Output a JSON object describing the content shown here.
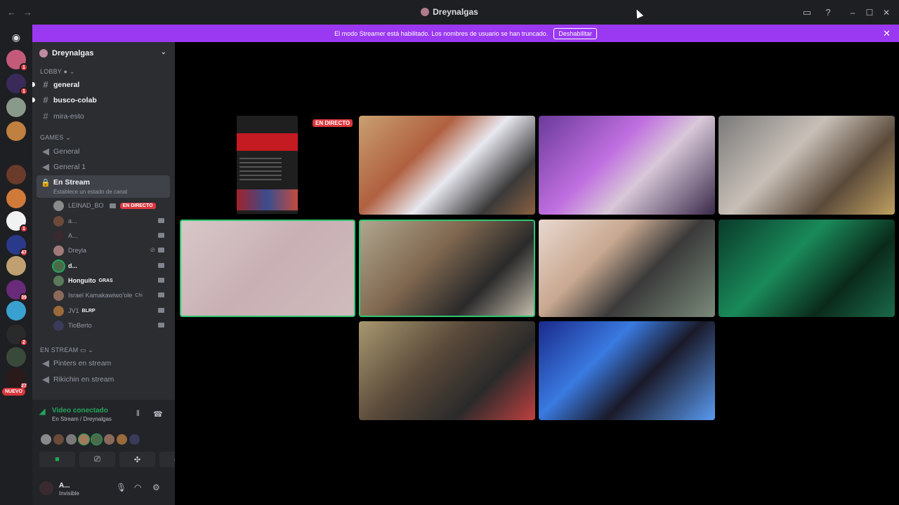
{
  "window": {
    "title": "Dreynalgas"
  },
  "banner": {
    "message": "El modo Streamer está habilitado. Los nombres de usuario se han truncado.",
    "button_label": "Deshabilitar"
  },
  "guild_badges": [
    "1",
    "1",
    "1",
    "47",
    "39",
    "2",
    "27"
  ],
  "guild_new_label": "NUEVO",
  "server": {
    "name": "Dreynalgas",
    "categories": {
      "lobby": "LOBBY",
      "games": "GAMES",
      "en_stream": "EN STREAM"
    },
    "text_channels": [
      {
        "name": "general",
        "unread": true
      },
      {
        "name": "busco-colab",
        "unread": true
      },
      {
        "name": "mira-esto",
        "unread": false
      }
    ],
    "voice_channels": [
      {
        "name": "General"
      },
      {
        "name": "General 1"
      },
      {
        "name": "En Stream",
        "status_hint": "Establece un estado de canal"
      }
    ],
    "voice_users": [
      {
        "name": "LEINAD_BO",
        "live": "EN DIRECTO",
        "bold": false,
        "color": "#8a8a8a"
      },
      {
        "name": "a...",
        "bold": false,
        "color": "#6b4a3a"
      },
      {
        "name": "A...",
        "bold": false,
        "color": "#3a2a30"
      },
      {
        "name": "Dreyla",
        "bold": false,
        "color": "#a07a7a"
      },
      {
        "name": "d...",
        "bold": true,
        "color": "#4a6a4a"
      },
      {
        "name": "Honguito",
        "tag": "GRAS",
        "bold": true,
        "color": "#5a7a5a"
      },
      {
        "name": "Israel Kamakawiwo'ole",
        "tag": "Chi",
        "bold": false,
        "color": "#8a6a5a"
      },
      {
        "name": "JV1",
        "tag": "BLRP",
        "bold": false,
        "color": "#9a6a3a"
      },
      {
        "name": "TioBerto",
        "bold": false,
        "color": "#3a3a5a"
      }
    ],
    "stream_channels": [
      {
        "name": "Pinters en stream"
      },
      {
        "name": "Rikichin en stream"
      }
    ]
  },
  "voice_panel": {
    "status": "Video conectado",
    "location": "En Stream / Dreynalgas"
  },
  "user": {
    "name": "A...",
    "status": "Invisible"
  },
  "stage": {
    "live_label": "EN DIRECTO"
  },
  "colors": {
    "accent": "#9b38f1",
    "live": "#da373c",
    "speaking": "#2dc770",
    "connected": "#23a55a"
  }
}
